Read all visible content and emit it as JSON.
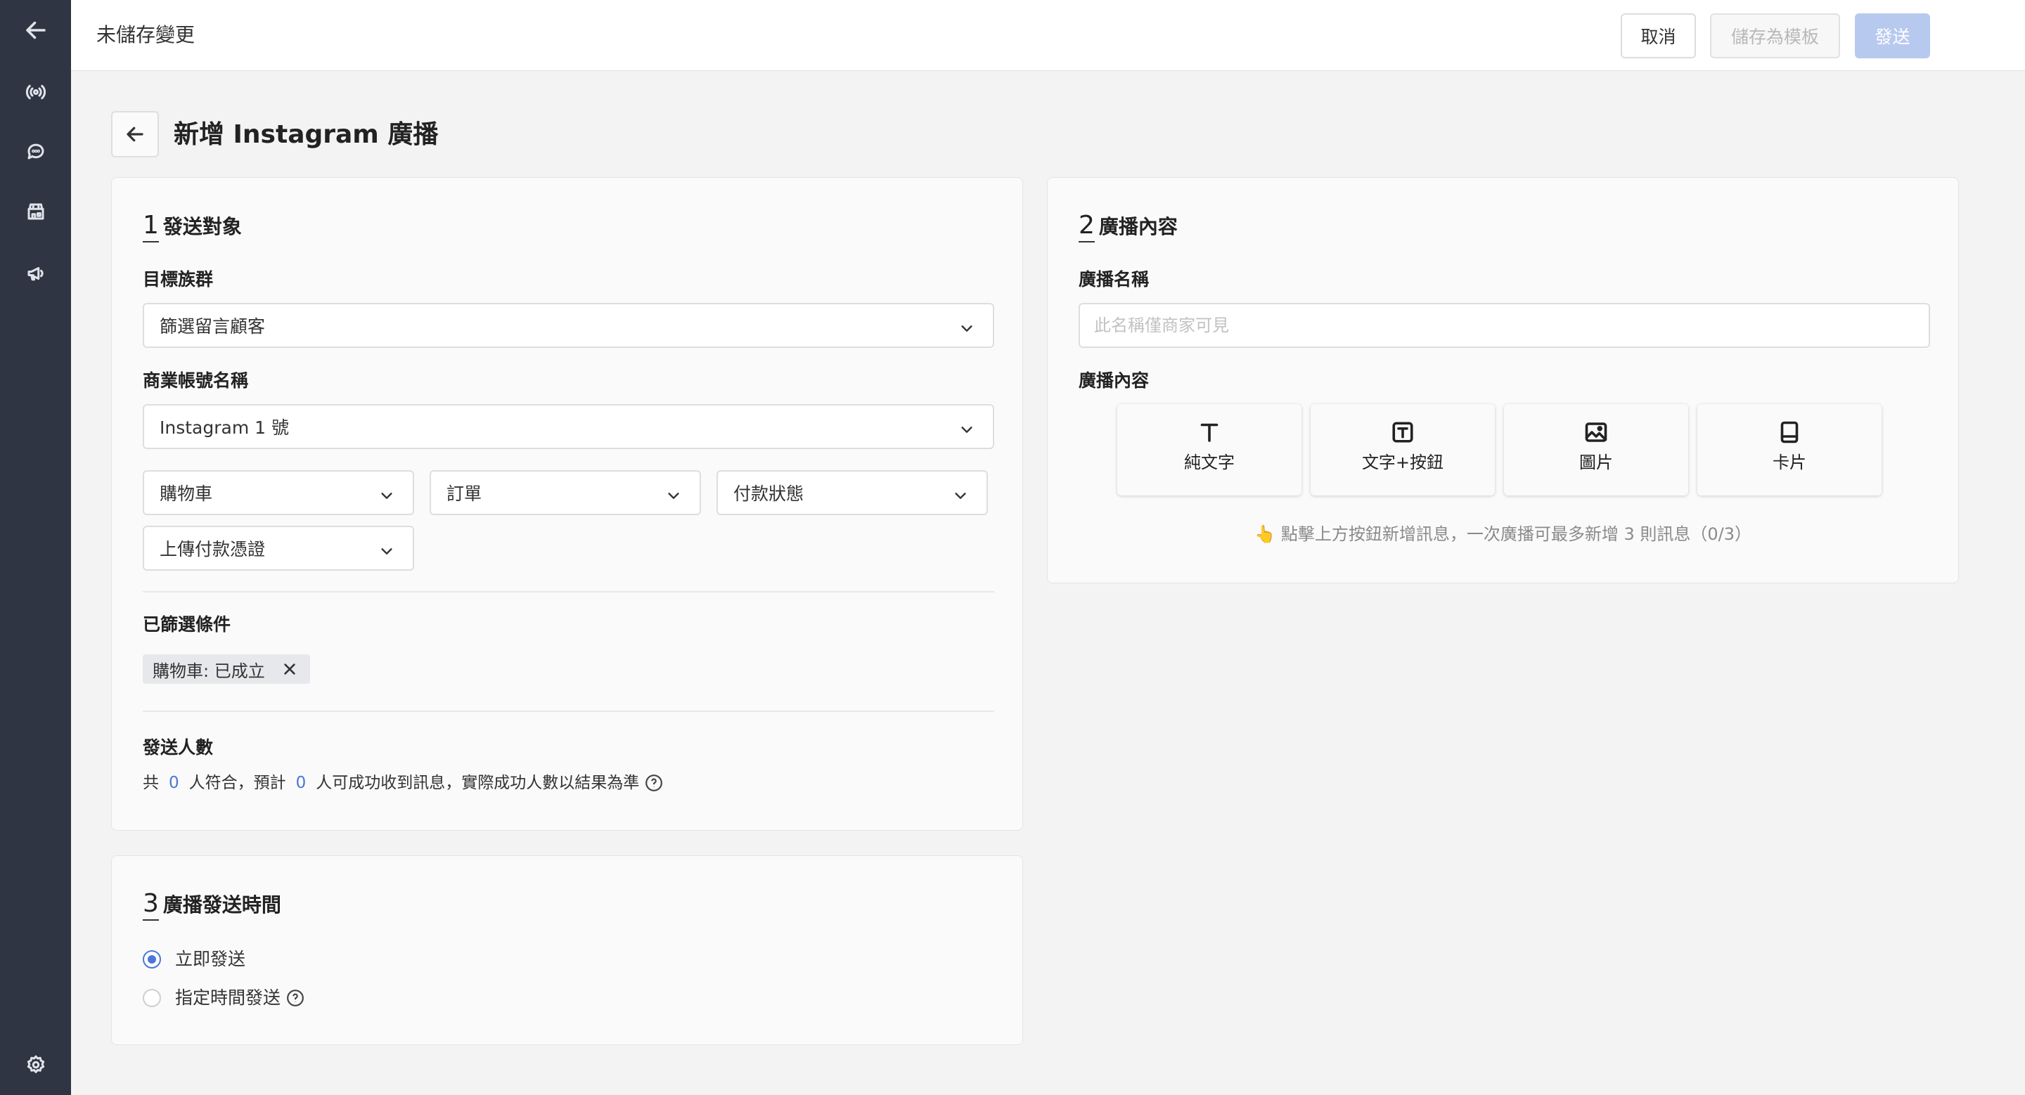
{
  "topbar": {
    "title": "未儲存變更",
    "cancel_label": "取消",
    "save_template_label": "儲存為模板",
    "send_label": "發送"
  },
  "page": {
    "title": "新增 Instagram 廣播"
  },
  "section1": {
    "number": "1",
    "title": "發送對象",
    "target_label": "目標族群",
    "target_value": "篩選留言顧客",
    "account_label": "商業帳號名稱",
    "account_value": "Instagram 1 號",
    "filters": [
      "購物車",
      "訂單",
      "付款狀態",
      "上傳付款憑證"
    ],
    "selected_label": "已篩選條件",
    "selected_tag": "購物車: 已成立",
    "count_label": "發送人數",
    "count_prefix": "共",
    "count_matched": "0",
    "count_mid": "人符合，預計",
    "count_expected": "0",
    "count_suffix": "人可成功收到訊息，實際成功人數以結果為準"
  },
  "section2": {
    "number": "2",
    "title": "廣播內容",
    "name_label": "廣播名稱",
    "name_placeholder": "此名稱僅商家可見",
    "content_label": "廣播內容",
    "types": [
      "純文字",
      "文字+按鈕",
      "圖片",
      "卡片"
    ],
    "hint_icon": "👆",
    "hint": "點擊上方按鈕新增訊息，一次廣播可最多新增 3 則訊息（0/3）"
  },
  "section3": {
    "number": "3",
    "title": "廣播發送時間",
    "option_now": "立即發送",
    "option_scheduled": "指定時間發送",
    "selected": "立即發送"
  },
  "colors": {
    "sidebar": "#2f3542",
    "accent": "#4a78d6",
    "send_disabled": "#b8c9ef"
  },
  "icons": {
    "sidebar": [
      "arrow-left-icon",
      "broadcast-icon",
      "chat-icon",
      "shop-icon",
      "megaphone-icon",
      "settings-gear-icon"
    ]
  }
}
